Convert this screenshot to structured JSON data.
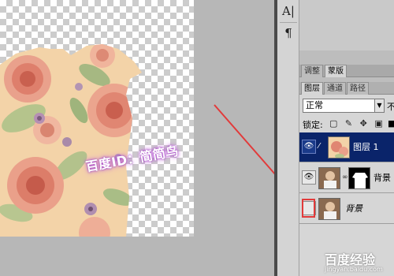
{
  "canvas": {
    "watermark": "百度ID：简简鸟"
  },
  "toolbar": {
    "tools": [
      {
        "glyph": "A|",
        "icon": "character-panel-icon"
      },
      {
        "glyph": "¶",
        "icon": "paragraph-panel-icon"
      }
    ]
  },
  "panel": {
    "tabs_top": [
      "调整",
      "蒙版"
    ],
    "tabs": [
      "图层",
      "通道",
      "路径"
    ],
    "blend_mode": "正常",
    "blend_extra": "不",
    "lock_label": "锁定:",
    "lock_icons": "▢ ✎ ✥ ▣",
    "layers": [
      {
        "name": "图层 1",
        "selected": true,
        "visible": true
      },
      {
        "name": "背景 副",
        "selected": false,
        "visible": true
      },
      {
        "name": "背景",
        "selected": false,
        "visible": false
      }
    ]
  },
  "footer": {
    "brand": "百度经验",
    "url": "jingyan.baidu.com"
  },
  "colors": {
    "selected_layer": "#0a246a",
    "annotation": "#e23a3a"
  }
}
